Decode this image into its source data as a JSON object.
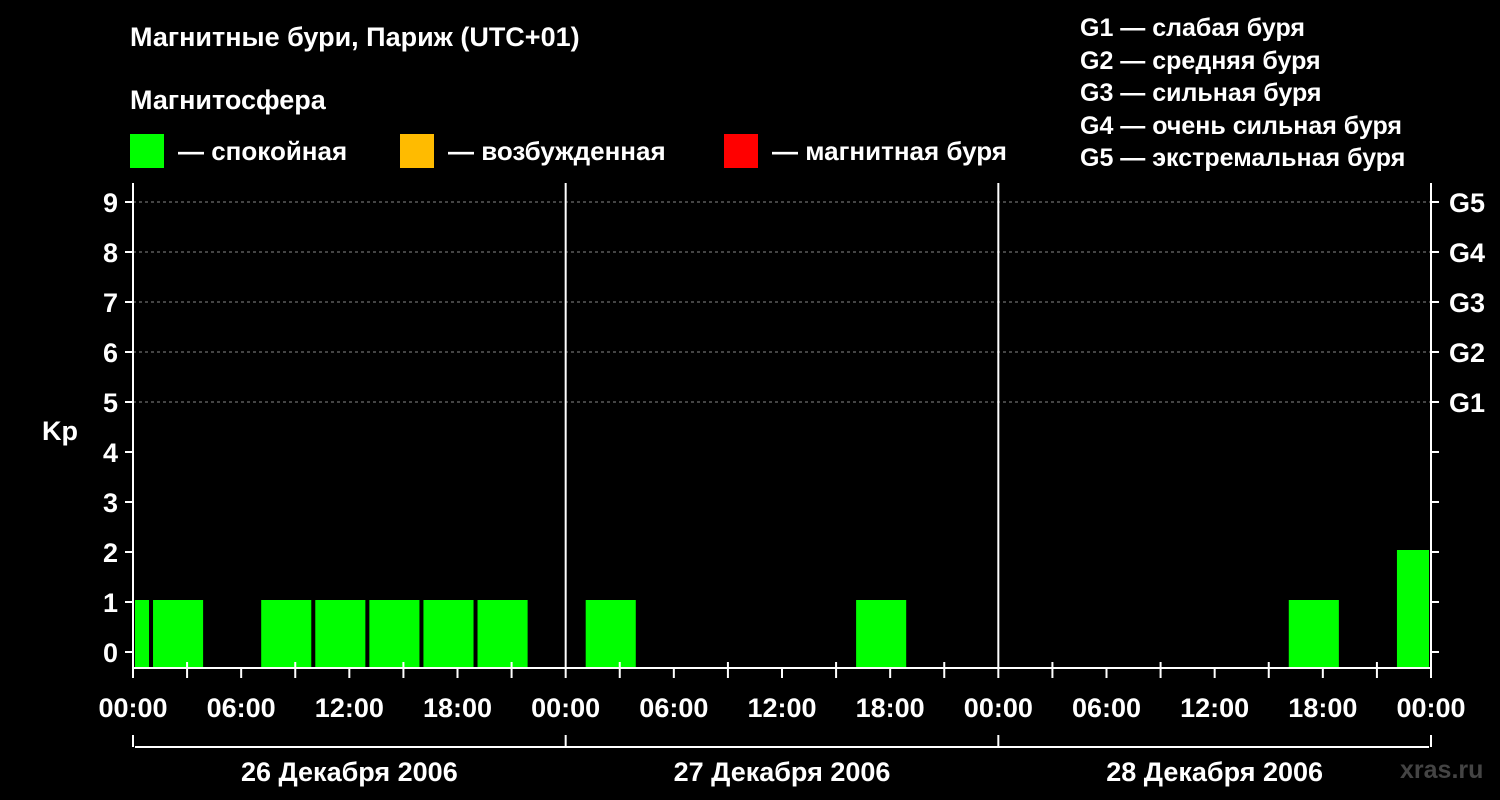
{
  "title": "Магнитные бури, Париж (UTC+01)",
  "subtitle": "Магнитосфера",
  "legend": [
    {
      "label": "— спокойная",
      "color": "#00ff00"
    },
    {
      "label": "— возбужденная",
      "color": "#ffbb00"
    },
    {
      "label": "— магнитная буря",
      "color": "#ff0000"
    }
  ],
  "g_legend": [
    "G1 — слабая буря",
    "G2 — средняя буря",
    "G3 — сильная буря",
    "G4 — очень сильная буря",
    "G5 — экстремальная буря"
  ],
  "watermark": "xras.ru",
  "chart_data": {
    "type": "bar",
    "ylabel": "Kp",
    "ylim": [
      0,
      9
    ],
    "y_ticks": [
      "0",
      "1",
      "2",
      "3",
      "4",
      "5",
      "6",
      "7",
      "8",
      "9"
    ],
    "right_ticks": [
      {
        "y": 5,
        "label": "G1"
      },
      {
        "y": 6,
        "label": "G2"
      },
      {
        "y": 7,
        "label": "G3"
      },
      {
        "y": 8,
        "label": "G4"
      },
      {
        "y": 9,
        "label": "G5"
      }
    ],
    "x_tick_labels": [
      "00:00",
      "06:00",
      "12:00",
      "18:00",
      "00:00",
      "06:00",
      "12:00",
      "18:00",
      "00:00",
      "06:00",
      "12:00",
      "18:00",
      "00:00"
    ],
    "x_range_hours": [
      0,
      72
    ],
    "days": [
      "26 Декабря 2006",
      "27 Декабря 2006",
      "28 Декабря 2006"
    ],
    "grid": "dashed horizontal at Kp 5–9",
    "bars": [
      {
        "start_hour": 0,
        "end_hour": 1,
        "kp": 1,
        "color": "#00ff00"
      },
      {
        "start_hour": 1,
        "end_hour": 4,
        "kp": 1,
        "color": "#00ff00"
      },
      {
        "start_hour": 7,
        "end_hour": 10,
        "kp": 1,
        "color": "#00ff00"
      },
      {
        "start_hour": 10,
        "end_hour": 13,
        "kp": 1,
        "color": "#00ff00"
      },
      {
        "start_hour": 13,
        "end_hour": 16,
        "kp": 1,
        "color": "#00ff00"
      },
      {
        "start_hour": 16,
        "end_hour": 19,
        "kp": 1,
        "color": "#00ff00"
      },
      {
        "start_hour": 19,
        "end_hour": 22,
        "kp": 1,
        "color": "#00ff00"
      },
      {
        "start_hour": 25,
        "end_hour": 28,
        "kp": 1,
        "color": "#00ff00"
      },
      {
        "start_hour": 40,
        "end_hour": 43,
        "kp": 1,
        "color": "#00ff00"
      },
      {
        "start_hour": 64,
        "end_hour": 67,
        "kp": 1,
        "color": "#00ff00"
      },
      {
        "start_hour": 70,
        "end_hour": 72,
        "kp": 2,
        "color": "#00ff00"
      }
    ]
  }
}
